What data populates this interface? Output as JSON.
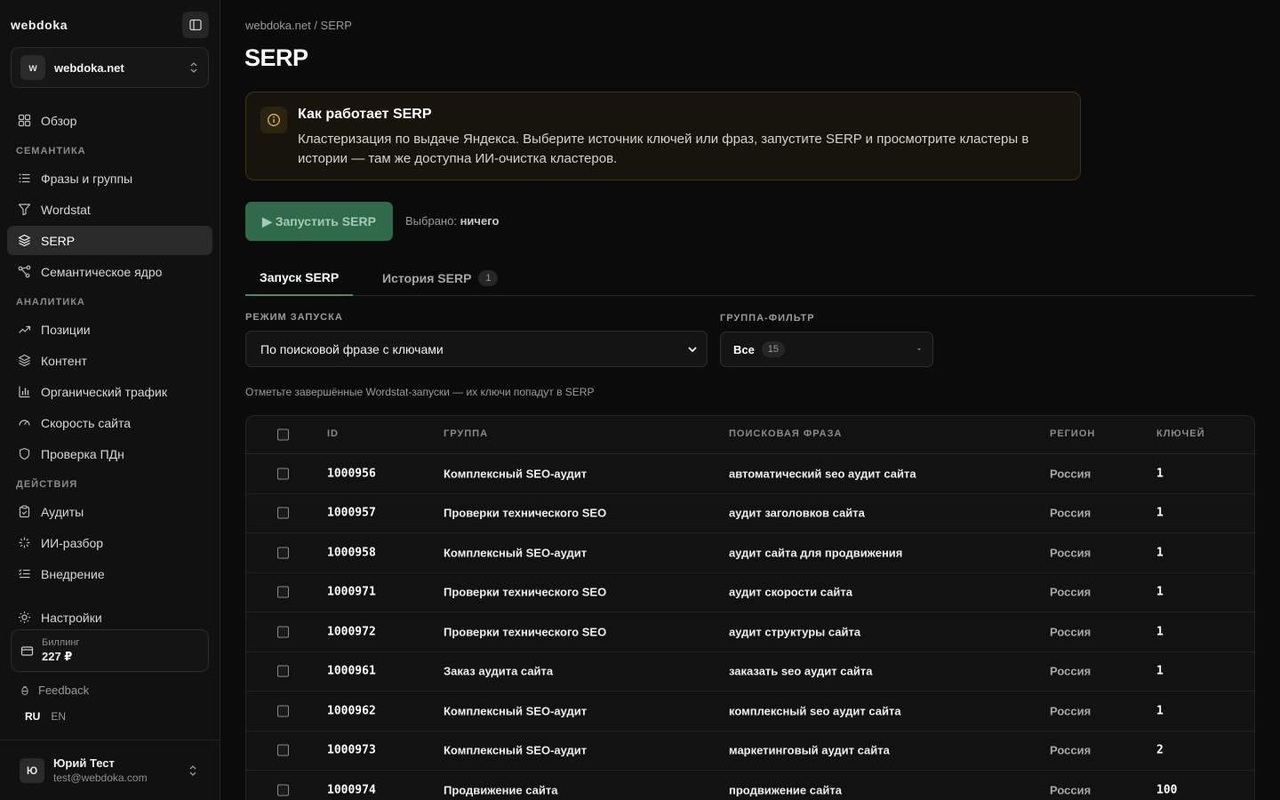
{
  "app": {
    "brand": "webdoka"
  },
  "site": {
    "avatar": "w",
    "name": "webdoka.net"
  },
  "nav": {
    "overview": "Обзор",
    "section_semantics": "СЕМАНТИКА",
    "phrases": "Фразы и группы",
    "wordstat": "Wordstat",
    "serp": "SERP",
    "semantic_core": "Семантическое ядро",
    "section_analytics": "АНАЛИТИКА",
    "positions": "Позиции",
    "content": "Контент",
    "organic": "Органический трафик",
    "speed": "Скорость сайта",
    "pdn": "Проверка ПДн",
    "section_actions": "ДЕЙСТВИЯ",
    "audits": "Аудиты",
    "ai": "ИИ-разбор",
    "implementation": "Внедрение",
    "settings": "Настройки"
  },
  "billing": {
    "label": "Биллинг",
    "value": "227 ₽"
  },
  "feedback": "Feedback",
  "lang": {
    "ru": "RU",
    "en": "EN"
  },
  "user": {
    "avatar": "Ю",
    "name": "Юрий Тест",
    "email": "test@webdoka.com"
  },
  "breadcrumb": "webdoka.net / SERP",
  "page_title": "SERP",
  "info": {
    "title": "Как работает SERP",
    "text": "Кластеризация по выдаче Яндекса. Выберите источник ключей или фраз, запустите SERP и просмотрите кластеры в истории — там же доступна ИИ-очистка кластеров."
  },
  "run_button": "▶ Запустить SERP",
  "selected": {
    "label": "Выбрано:",
    "value": "ничего"
  },
  "tabs": [
    {
      "label": "Запуск SERP"
    },
    {
      "label": "История SERP",
      "badge": "1"
    }
  ],
  "mode": {
    "label": "РЕЖИМ ЗАПУСКА",
    "value": "По поисковой фразе с ключами"
  },
  "group_filter": {
    "label": "ГРУППА-ФИЛЬТР",
    "value": "Все",
    "count": "15"
  },
  "hint": "Отметьте завершённые Wordstat-запуски — их ключи попадут в SERP",
  "table": {
    "headers": {
      "id": "ID",
      "group": "ГРУППА",
      "phrase": "ПОИСКОВАЯ ФРАЗА",
      "region": "РЕГИОН",
      "keys": "КЛЮЧЕЙ"
    },
    "rows": [
      {
        "id": "1000956",
        "group": "Комплексный SEO-аудит",
        "phrase": "автоматический seo аудит сайта",
        "region": "Россия",
        "keys": "1"
      },
      {
        "id": "1000957",
        "group": "Проверки технического SEO",
        "phrase": "аудит заголовков сайта",
        "region": "Россия",
        "keys": "1"
      },
      {
        "id": "1000958",
        "group": "Комплексный SEO-аудит",
        "phrase": "аудит сайта для продвижения",
        "region": "Россия",
        "keys": "1"
      },
      {
        "id": "1000971",
        "group": "Проверки технического SEO",
        "phrase": "аудит скорости сайта",
        "region": "Россия",
        "keys": "1"
      },
      {
        "id": "1000972",
        "group": "Проверки технического SEO",
        "phrase": "аудит структуры сайта",
        "region": "Россия",
        "keys": "1"
      },
      {
        "id": "1000961",
        "group": "Заказ аудита сайта",
        "phrase": "заказать seo аудит сайта",
        "region": "Россия",
        "keys": "1"
      },
      {
        "id": "1000962",
        "group": "Комплексный SEO-аудит",
        "phrase": "комплексный seo аудит сайта",
        "region": "Россия",
        "keys": "1"
      },
      {
        "id": "1000973",
        "group": "Комплексный SEO-аудит",
        "phrase": "маркетинговый аудит сайта",
        "region": "Россия",
        "keys": "2"
      },
      {
        "id": "1000974",
        "group": "Продвижение сайта",
        "phrase": "продвижение сайта",
        "region": "Россия",
        "keys": "100"
      }
    ]
  }
}
